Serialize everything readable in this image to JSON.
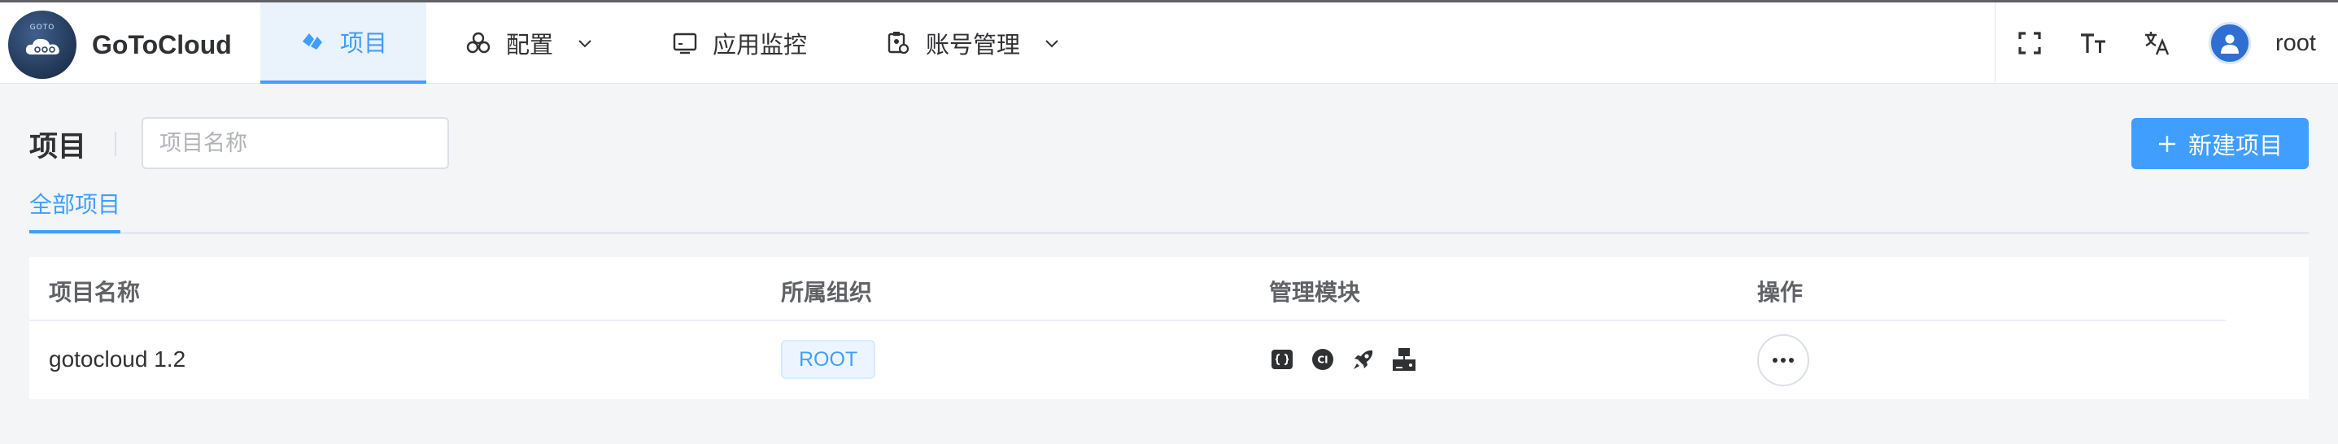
{
  "app": {
    "name": "GoToCloud",
    "logo_text": "GOTO"
  },
  "nav": {
    "items": [
      {
        "label": "项目",
        "icon": "project-icon",
        "active": true
      },
      {
        "label": "配置",
        "icon": "config-icon",
        "has_dropdown": true
      },
      {
        "label": "应用监控",
        "icon": "monitor-icon"
      },
      {
        "label": "账号管理",
        "icon": "account-icon",
        "has_dropdown": true
      }
    ]
  },
  "header_tools": {
    "fullscreen_icon": "fullscreen-icon",
    "font_size_icon": "font-size-icon",
    "language_icon": "translate-icon",
    "user_name": "root"
  },
  "page": {
    "title": "项目",
    "search_placeholder": "项目名称",
    "new_button_label": "新建项目",
    "tabs": [
      {
        "label": "全部项目",
        "active": true
      }
    ]
  },
  "table": {
    "columns": [
      "项目名称",
      "所属组织",
      "管理模块",
      "操作"
    ],
    "rows": [
      {
        "name": "gotocloud 1.2",
        "org": "ROOT",
        "modules": [
          "code-icon",
          "ci-icon",
          "deploy-rocket-icon",
          "server-icon"
        ]
      }
    ]
  },
  "colors": {
    "primary": "#409eff",
    "active_nav_bg": "#eaf2fb",
    "page_bg": "#f4f5f7"
  }
}
